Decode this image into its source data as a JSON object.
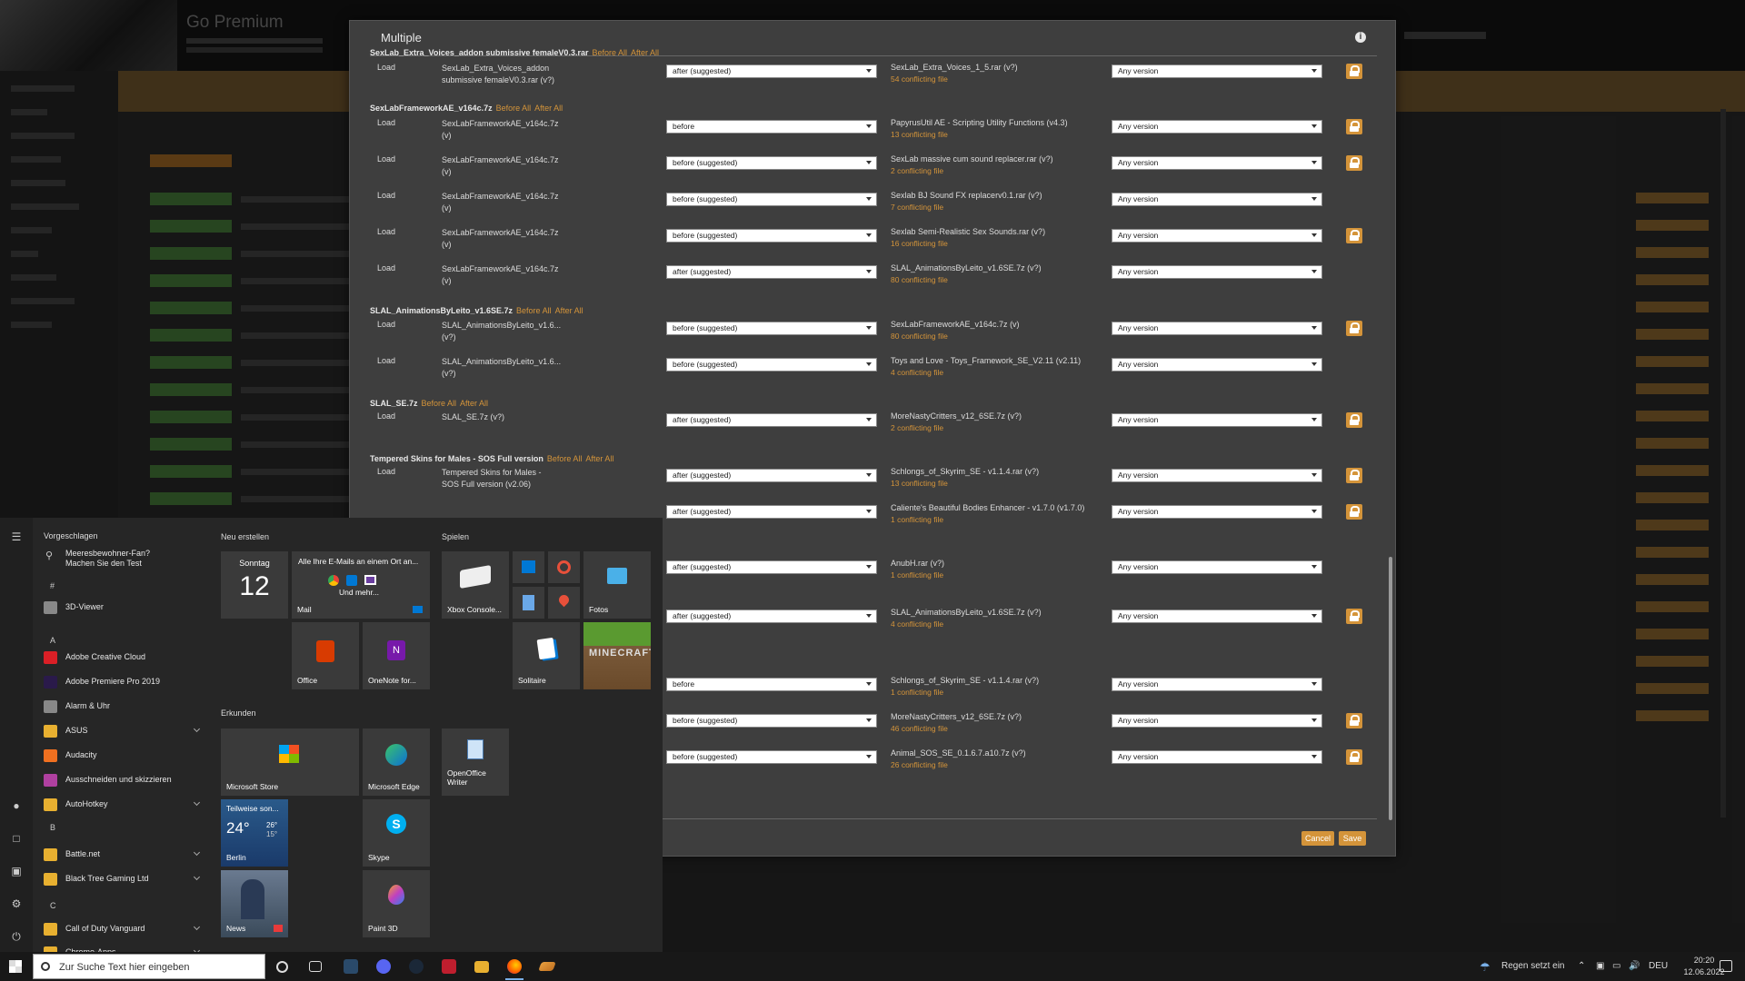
{
  "dialog": {
    "title": "Multiple",
    "cancel_label": "Cancel",
    "save_label": "Save",
    "groups": [
      {
        "title": "SexLab_Extra_Voices_addon submissive femaleV0.3.rar",
        "before_all": "Before All",
        "after_all": "After All"
      },
      {
        "title": "SexLabFrameworkAE_v164c.7z",
        "before_all": "Before All",
        "after_all": "After All"
      },
      {
        "title": "SLAL_AnimationsByLeito_v1.6SE.7z",
        "before_all": "Before All",
        "after_all": "After All"
      },
      {
        "title": "SLAL_SE.7z",
        "before_all": "Before All",
        "after_all": "After All"
      },
      {
        "title": "Tempered Skins for Males - SOS Full version",
        "before_all": "Before All",
        "after_all": "After All"
      }
    ],
    "rows": [
      {
        "load": "Load",
        "source": "SexLab_Extra_Voices_addon submissive femaleV0.3.rar (v?)",
        "order": "after (suggested)",
        "target": "SexLab_Extra_Voices_1_5.rar (v?)",
        "conflicts": "54 conflicting file",
        "version": "Any version"
      },
      {
        "load": "Load",
        "source": "SexLabFrameworkAE_v164c.7z (v)",
        "order": "before",
        "target": "PapyrusUtil AE - Scripting Utility Functions (v4.3)",
        "conflicts": "13 conflicting file",
        "version": "Any version"
      },
      {
        "load": "Load",
        "source": "SexLabFrameworkAE_v164c.7z (v)",
        "order": "before (suggested)",
        "target": "SexLab massive cum sound replacer.rar (v?)",
        "conflicts": "2 conflicting file",
        "version": "Any version"
      },
      {
        "load": "Load",
        "source": "SexLabFrameworkAE_v164c.7z (v)",
        "order": "before (suggested)",
        "target": "Sexlab BJ Sound FX replacerv0.1.rar (v?)",
        "conflicts": "7 conflicting file",
        "version": "Any version"
      },
      {
        "load": "Load",
        "source": "SexLabFrameworkAE_v164c.7z (v)",
        "order": "before (suggested)",
        "target": "Sexlab Semi-Realistic Sex Sounds.rar (v?)",
        "conflicts": "16 conflicting file",
        "version": "Any version"
      },
      {
        "load": "Load",
        "source": "SexLabFrameworkAE_v164c.7z (v)",
        "order": "after (suggested)",
        "target": "SLAL_AnimationsByLeito_v1.6SE.7z (v?)",
        "conflicts": "80 conflicting file",
        "version": "Any version"
      },
      {
        "load": "Load",
        "source": "SLAL_AnimationsByLeito_v1.6... (v?)",
        "order": "before (suggested)",
        "target": "SexLabFrameworkAE_v164c.7z (v)",
        "conflicts": "80 conflicting file",
        "version": "Any version"
      },
      {
        "load": "Load",
        "source": "SLAL_AnimationsByLeito_v1.6... (v?)",
        "order": "before (suggested)",
        "target": "Toys and Love - Toys_Framework_SE_V2.11 (v2.11)",
        "conflicts": "4 conflicting file",
        "version": "Any version"
      },
      {
        "load": "Load",
        "source": "SLAL_SE.7z (v?)",
        "order": "after (suggested)",
        "target": "MoreNastyCritters_v12_6SE.7z (v?)",
        "conflicts": "2 conflicting file",
        "version": "Any version"
      },
      {
        "load": "Load",
        "source": "Tempered Skins for Males - SOS Full version (v2.06)",
        "order": "after (suggested)",
        "target": "Schlongs_of_Skyrim_SE - v1.1.4.rar (v?)",
        "conflicts": "13 conflicting file",
        "version": "Any version"
      },
      {
        "load": "",
        "source": "",
        "order": "after (suggested)",
        "target": "Caliente's Beautiful Bodies Enhancer - v1.7.0 (v1.7.0)",
        "conflicts": "1 conflicting file",
        "version": "Any version"
      },
      {
        "load": "",
        "source": "",
        "order": "after (suggested)",
        "target": "AnubH.rar (v?)",
        "conflicts": "1 conflicting file",
        "version": "Any version"
      },
      {
        "load": "",
        "source": "",
        "order": "after (suggested)",
        "target": "SLAL_AnimationsByLeito_v1.6SE.7z (v?)",
        "conflicts": "4 conflicting file",
        "version": "Any version"
      },
      {
        "load": "",
        "source": "",
        "order": "before",
        "target": "Schlongs_of_Skyrim_SE - v1.1.4.rar (v?)",
        "conflicts": "1 conflicting file",
        "version": "Any version"
      },
      {
        "load": "",
        "source": "",
        "order": "before (suggested)",
        "target": "MoreNastyCritters_v12_6SE.7z (v?)",
        "conflicts": "46 conflicting file",
        "version": "Any version"
      },
      {
        "load": "",
        "source": "",
        "order": "before (suggested)",
        "target": "Animal_SOS_SE_0.1.6.7.a10.7z (v?)",
        "conflicts": "26 conflicting file",
        "version": "Any version"
      }
    ]
  },
  "start_menu": {
    "suggested_header": "Vorgeschlagen",
    "suggestion_line1": "Meeresbewohner-Fan?",
    "suggestion_line2": "Machen Sie den Test",
    "letters": [
      "#",
      "A",
      "B",
      "C"
    ],
    "apps": [
      {
        "label": "3D-Viewer",
        "color": "#888"
      },
      {
        "label": "Adobe Creative Cloud",
        "color": "#da1f26"
      },
      {
        "label": "Adobe Premiere Pro 2019",
        "color": "#2a1a4a"
      },
      {
        "label": "Alarm & Uhr",
        "color": "#888"
      },
      {
        "label": "ASUS",
        "color": "#e8b030"
      },
      {
        "label": "Audacity",
        "color": "#f07020"
      },
      {
        "label": "Ausschneiden und skizzieren",
        "color": "#b040a0"
      },
      {
        "label": "AutoHotkey",
        "color": "#e8b030"
      },
      {
        "label": "Battle.net",
        "color": "#e8b030"
      },
      {
        "label": "Black Tree Gaming Ltd",
        "color": "#e8b030"
      },
      {
        "label": "Call of Duty Vanguard",
        "color": "#e8b030"
      },
      {
        "label": "Chrome-Apps",
        "color": "#e8b030"
      }
    ],
    "create_header": "Neu erstellen",
    "play_header": "Spielen",
    "explore_header": "Erkunden",
    "calendar_day": "Sonntag",
    "calendar_date": "12",
    "mail_text": "Alle Ihre E-Mails an einem Ort an...",
    "mail_more": "Und mehr...",
    "tiles": {
      "mail": "Mail",
      "office": "Office",
      "onenote": "OneNote for...",
      "xbox": "Xbox Console...",
      "fotos": "Fotos",
      "solitaire": "Solitaire",
      "minecraft": "MINECRAFT",
      "store": "Microsoft Store",
      "edge": "Microsoft Edge",
      "openoffice": "OpenOffice Writer",
      "weather_head": "Teilweise son...",
      "weather_temp": "24°",
      "weather_hi": "26°",
      "weather_lo": "15°",
      "weather_city": "Berlin",
      "skype": "Skype",
      "news": "News",
      "paint3d": "Paint 3D"
    }
  },
  "background": {
    "title": "Go Premium"
  },
  "taskbar": {
    "search_placeholder": "Zur Suche Text hier eingeben",
    "weather": "Regen setzt ein",
    "language": "DEU",
    "time": "20:20",
    "date": "12.06.2022"
  }
}
